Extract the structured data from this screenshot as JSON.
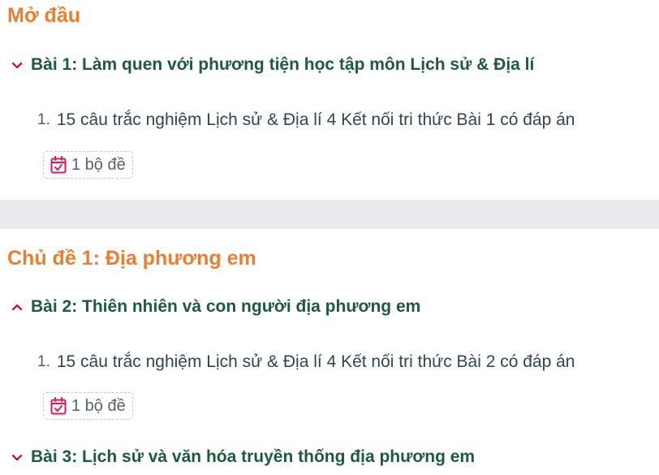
{
  "sections": [
    {
      "title": "Mở đầu",
      "lessons": [
        {
          "title": "Bài 1: Làm quen với phương tiện học tập môn Lịch sử & Địa lí",
          "expanded": true,
          "items": [
            {
              "number": "1.",
              "text": "15 câu trắc nghiệm Lịch sử & Địa lí 4 Kết nối tri thức Bài 1 có đáp án",
              "badge": "1 bộ đề"
            }
          ]
        }
      ]
    },
    {
      "title": "Chủ đề 1: Địa phương em",
      "lessons": [
        {
          "title": "Bài 2: Thiên nhiên và con người địa phương em",
          "expanded": false,
          "items": [
            {
              "number": "1.",
              "text": "15 câu trắc nghiệm Lịch sử & Địa lí 4 Kết nối tri thức Bài 2 có đáp án",
              "badge": "1 bộ đề"
            }
          ]
        },
        {
          "title": "Bài 3: Lịch sử và văn hóa truyền thống địa phương em",
          "expanded": true,
          "items": []
        }
      ]
    }
  ],
  "colors": {
    "chapter": "#ed7d31",
    "lesson": "#1e5b3c",
    "chevron": "#d0021b",
    "badge_icon": "#d81b60",
    "divider": "#e9ebee"
  },
  "icons": {
    "chevron_down": "chevron-down-icon",
    "chevron_up": "chevron-up-icon",
    "calendar_check": "calendar-check-icon"
  }
}
